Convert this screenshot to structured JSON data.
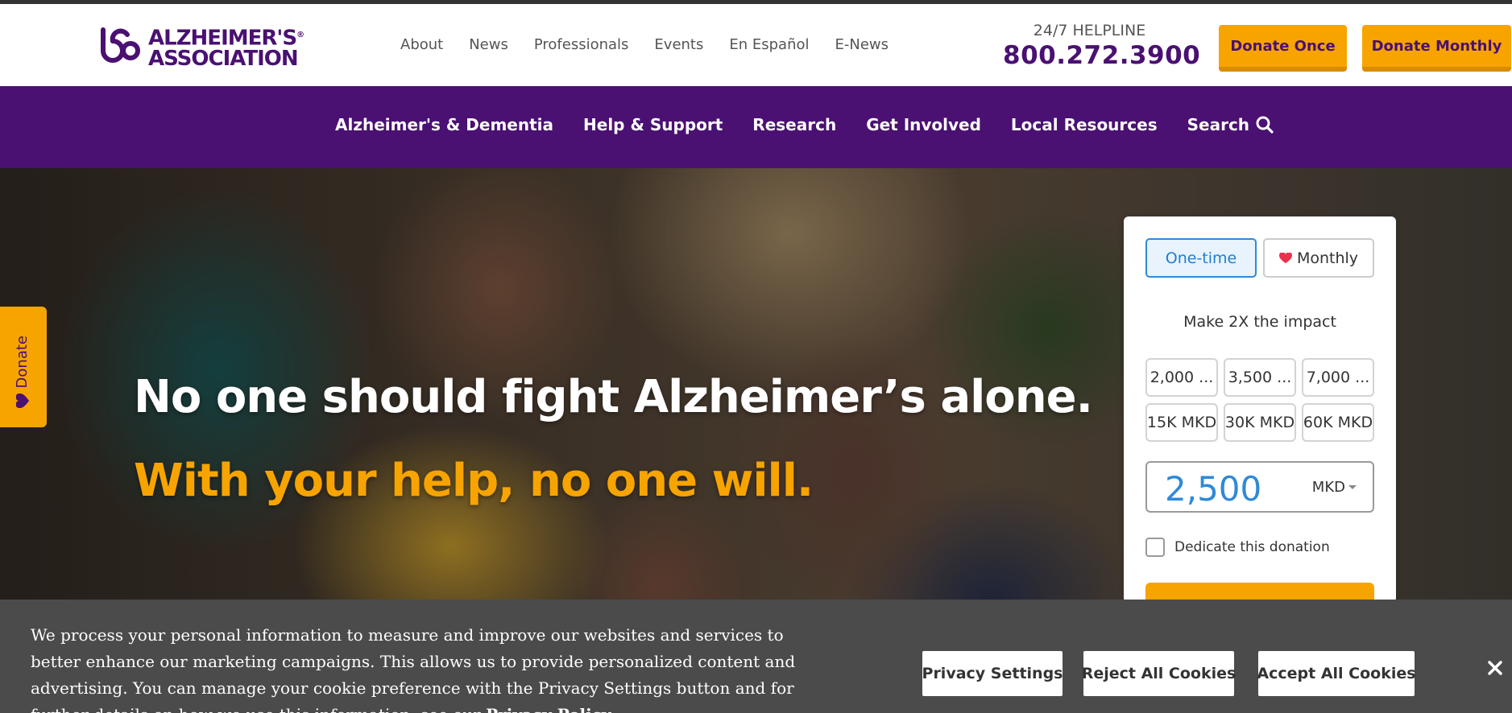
{
  "header": {
    "logo_line1": "ALZHEIMER'S",
    "logo_line2": "ASSOCIATION",
    "logo_reg": "®",
    "util_nav": [
      "About",
      "News",
      "Professionals",
      "Events",
      "En Español",
      "E-News"
    ],
    "helpline_label": "24/7 HELPLINE",
    "helpline_number": "800.272.3900",
    "donate_once": "Donate Once",
    "donate_monthly": "Donate Monthly"
  },
  "main_nav": {
    "items": [
      "Alzheimer's & Dementia",
      "Help & Support",
      "Research",
      "Get Involved",
      "Local Resources",
      "Search"
    ],
    "search_icon": "search-icon"
  },
  "hero": {
    "title": "No one should fight Alzheimer’s alone.",
    "subtitle": "With your help, no one will."
  },
  "side_tab": {
    "label": "Donate",
    "icon": "heart-icon"
  },
  "donation": {
    "one_time": "One-time",
    "monthly": "Monthly",
    "impact": "Make 2X the impact",
    "amounts": [
      "2,000 ...",
      "3,500 ...",
      "7,000 ...",
      "15K MKD",
      "30K MKD",
      "60K MKD"
    ],
    "amount_value": "2,500",
    "currency": "MKD",
    "dedicate": "Dedicate this donation"
  },
  "cookie": {
    "text": "We process your personal information to measure and improve our websites and services to better enhance our marketing campaigns. This allows us to provide personalized content and advertising. You can manage your cookie preference with the Privacy Settings button and for further details on how we use this information, see our",
    "privacy_link": "Privacy Policy",
    "privacy_settings": "Privacy Settings",
    "reject_all": "Reject All Cookies",
    "accept_all": "Accept All Cookies",
    "close_icon": "close-icon"
  },
  "colors": {
    "brand_purple": "#4a1072",
    "accent_orange": "#f7a400",
    "link_blue": "#2f8ad7",
    "banner_gray": "#4b4b4b"
  }
}
